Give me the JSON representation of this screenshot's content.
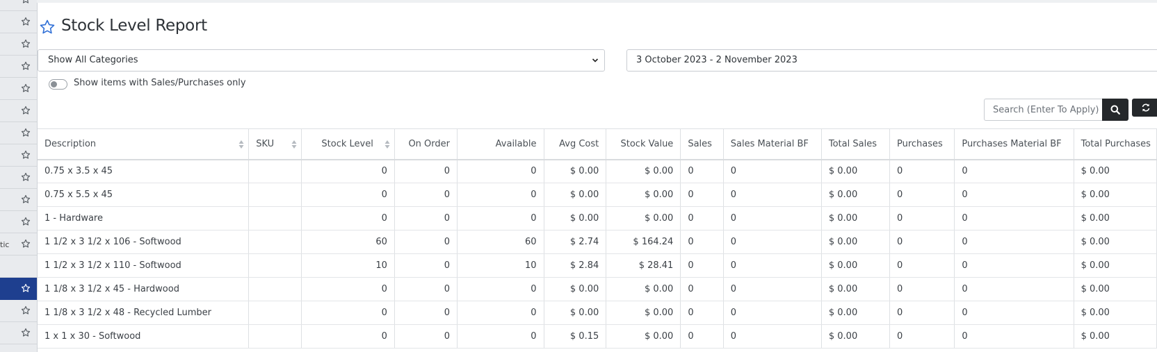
{
  "sidebar": {
    "fragment_text": "tic",
    "rows": 16,
    "active_index": 13,
    "accent_color": "#1e3f8f"
  },
  "page": {
    "title": "Stock Level Report",
    "title_icon": "star-outline-icon"
  },
  "filters": {
    "category_value": "Show All Categories",
    "date_range": "3 October 2023 - 2 November 2023",
    "toggle_label": "Show items with Sales/Purchases only",
    "toggle_on": false
  },
  "search": {
    "placeholder": "Search (Enter To Apply)",
    "search_icon": "search-icon",
    "refresh_icon": "refresh-icon"
  },
  "table": {
    "columns": [
      "Description",
      "SKU",
      "Stock Level",
      "On Order",
      "Available",
      "Avg Cost",
      "Stock Value",
      "Sales",
      "Sales Material BF",
      "Total Sales",
      "Purchases",
      "Purchases Material BF",
      "Total Purchases"
    ],
    "rows": [
      [
        "0.75 x 3.5 x 45",
        "",
        "0",
        "0",
        "0",
        "$ 0.00",
        "$ 0.00",
        "0",
        "0",
        "$ 0.00",
        "0",
        "0",
        "$ 0.00"
      ],
      [
        "0.75 x 5.5 x 45",
        "",
        "0",
        "0",
        "0",
        "$ 0.00",
        "$ 0.00",
        "0",
        "0",
        "$ 0.00",
        "0",
        "0",
        "$ 0.00"
      ],
      [
        "1 - Hardware",
        "",
        "0",
        "0",
        "0",
        "$ 0.00",
        "$ 0.00",
        "0",
        "0",
        "$ 0.00",
        "0",
        "0",
        "$ 0.00"
      ],
      [
        "1 1/2 x 3 1/2 x 106 - Softwood",
        "",
        "60",
        "0",
        "60",
        "$ 2.74",
        "$ 164.24",
        "0",
        "0",
        "$ 0.00",
        "0",
        "0",
        "$ 0.00"
      ],
      [
        "1 1/2 x 3 1/2 x 110 - Softwood",
        "",
        "10",
        "0",
        "10",
        "$ 2.84",
        "$ 28.41",
        "0",
        "0",
        "$ 0.00",
        "0",
        "0",
        "$ 0.00"
      ],
      [
        "1 1/8 x 3 1/2 x 45 - Hardwood",
        "",
        "0",
        "0",
        "0",
        "$ 0.00",
        "$ 0.00",
        "0",
        "0",
        "$ 0.00",
        "0",
        "0",
        "$ 0.00"
      ],
      [
        "1 1/8 x 3 1/2 x 48 - Recycled Lumber",
        "",
        "0",
        "0",
        "0",
        "$ 0.00",
        "$ 0.00",
        "0",
        "0",
        "$ 0.00",
        "0",
        "0",
        "$ 0.00"
      ],
      [
        "1 x 1 x 30 - Softwood",
        "",
        "0",
        "0",
        "0",
        "$ 0.15",
        "$ 0.00",
        "0",
        "0",
        "$ 0.00",
        "0",
        "0",
        "$ 0.00"
      ]
    ]
  }
}
